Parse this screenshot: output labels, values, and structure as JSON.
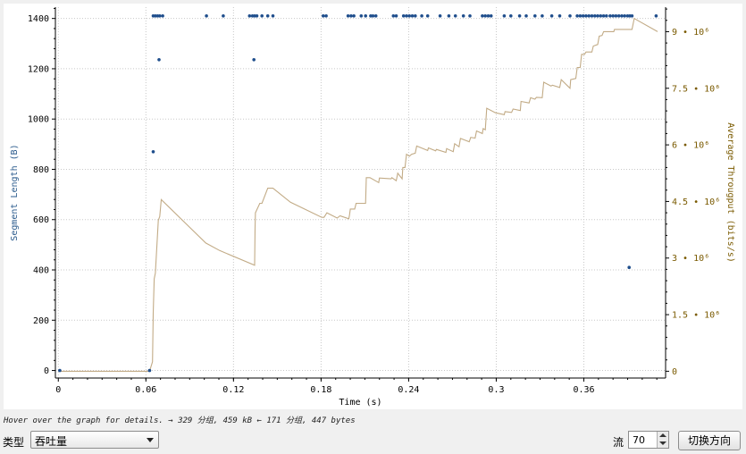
{
  "status_text": "Hover over the graph for details. → 329 分组, 459 kB ← 171 分组, 447 bytes",
  "controls": {
    "type_label": "类型",
    "type_value": "吞吐量",
    "stream_label": "流",
    "stream_value": "70",
    "switch_direction_label": "切换方向"
  },
  "colors": {
    "segment_points": "#1f4e8c",
    "throughput_line": "#c2ab86",
    "left_axis_text": "#2a5a8c",
    "right_axis_text": "#7a5a00"
  },
  "chart_data": {
    "type": "scatter",
    "grid": true,
    "xlabel": "Time (s)",
    "ylabel": "Segment Length (B)",
    "y2label": "Average Througput (bits/s)",
    "xlim": [
      -0.002,
      0.416
    ],
    "ylim": [
      -30,
      1445
    ],
    "y2lim": [
      -180000,
      9650000
    ],
    "x_ticks": [
      {
        "v": 0,
        "label": "0"
      },
      {
        "v": 0.06,
        "label": "0.06"
      },
      {
        "v": 0.12,
        "label": "0.12"
      },
      {
        "v": 0.18,
        "label": "0.18"
      },
      {
        "v": 0.24,
        "label": "0.24"
      },
      {
        "v": 0.3,
        "label": "0.3"
      },
      {
        "v": 0.36,
        "label": "0.36"
      }
    ],
    "y_ticks": [
      {
        "v": 0,
        "label": "0"
      },
      {
        "v": 200,
        "label": "200"
      },
      {
        "v": 400,
        "label": "400"
      },
      {
        "v": 600,
        "label": "600"
      },
      {
        "v": 800,
        "label": "800"
      },
      {
        "v": 1000,
        "label": "1000"
      },
      {
        "v": 1200,
        "label": "1200"
      },
      {
        "v": 1400,
        "label": "1400"
      }
    ],
    "y2_ticks": [
      {
        "v": 0,
        "label": "0"
      },
      {
        "v": 1500000,
        "label": "1.5 • 10⁶"
      },
      {
        "v": 3000000,
        "label": "3 • 10⁶"
      },
      {
        "v": 4500000,
        "label": "4.5 • 10⁶"
      },
      {
        "v": 6000000,
        "label": "6 • 10⁶"
      },
      {
        "v": 7500000,
        "label": "7.5 • 10⁶"
      },
      {
        "v": 9000000,
        "label": "9 • 10⁶"
      }
    ],
    "series": [
      {
        "name": "Segment Length",
        "kind": "points",
        "points": [
          [
            0.001,
            0
          ],
          [
            0.0625,
            0
          ],
          [
            0.065,
            870
          ],
          [
            0.069,
            1236
          ],
          [
            0.134,
            1236
          ],
          [
            0.391,
            410
          ],
          [
            0.065,
            1410
          ],
          [
            0.0665,
            1410
          ],
          [
            0.068,
            1410
          ],
          [
            0.0695,
            1410
          ],
          [
            0.0715,
            1410
          ],
          [
            0.1015,
            1410
          ],
          [
            0.113,
            1410
          ],
          [
            0.131,
            1410
          ],
          [
            0.133,
            1410
          ],
          [
            0.1345,
            1410
          ],
          [
            0.136,
            1410
          ],
          [
            0.1395,
            1410
          ],
          [
            0.1435,
            1410
          ],
          [
            0.147,
            1410
          ],
          [
            0.1815,
            1410
          ],
          [
            0.1835,
            1410
          ],
          [
            0.1985,
            1410
          ],
          [
            0.2005,
            1410
          ],
          [
            0.2025,
            1410
          ],
          [
            0.2075,
            1410
          ],
          [
            0.2105,
            1410
          ],
          [
            0.214,
            1410
          ],
          [
            0.2155,
            1410
          ],
          [
            0.2175,
            1410
          ],
          [
            0.2295,
            1410
          ],
          [
            0.2315,
            1410
          ],
          [
            0.2365,
            1410
          ],
          [
            0.2385,
            1410
          ],
          [
            0.2405,
            1410
          ],
          [
            0.2425,
            1410
          ],
          [
            0.2445,
            1410
          ],
          [
            0.249,
            1410
          ],
          [
            0.253,
            1410
          ],
          [
            0.2615,
            1410
          ],
          [
            0.2675,
            1410
          ],
          [
            0.272,
            1410
          ],
          [
            0.2775,
            1410
          ],
          [
            0.282,
            1410
          ],
          [
            0.2905,
            1410
          ],
          [
            0.2925,
            1410
          ],
          [
            0.2945,
            1410
          ],
          [
            0.2965,
            1410
          ],
          [
            0.3055,
            1410
          ],
          [
            0.31,
            1410
          ],
          [
            0.316,
            1410
          ],
          [
            0.3205,
            1410
          ],
          [
            0.3265,
            1410
          ],
          [
            0.3315,
            1410
          ],
          [
            0.338,
            1410
          ],
          [
            0.3435,
            1410
          ],
          [
            0.3505,
            1410
          ],
          [
            0.3555,
            1410
          ],
          [
            0.3575,
            1410
          ],
          [
            0.3595,
            1410
          ],
          [
            0.3615,
            1410
          ],
          [
            0.3635,
            1410
          ],
          [
            0.3655,
            1410
          ],
          [
            0.3675,
            1410
          ],
          [
            0.3695,
            1410
          ],
          [
            0.3715,
            1410
          ],
          [
            0.3735,
            1410
          ],
          [
            0.3755,
            1410
          ],
          [
            0.378,
            1410
          ],
          [
            0.38,
            1410
          ],
          [
            0.382,
            1410
          ],
          [
            0.384,
            1410
          ],
          [
            0.386,
            1410
          ],
          [
            0.388,
            1410
          ],
          [
            0.39,
            1410
          ],
          [
            0.3915,
            1410
          ],
          [
            0.393,
            1410
          ],
          [
            0.4095,
            1410
          ]
        ]
      },
      {
        "name": "Average Throughput",
        "kind": "line",
        "axis": "right",
        "points": [
          [
            0,
            0
          ],
          [
            0.0625,
            0
          ],
          [
            0.0645,
            250000
          ],
          [
            0.065,
            1550000
          ],
          [
            0.0657,
            2450000
          ],
          [
            0.0665,
            2600000
          ],
          [
            0.0685,
            4000000
          ],
          [
            0.0695,
            4100000
          ],
          [
            0.0705,
            4550000
          ],
          [
            0.101,
            3400000
          ],
          [
            0.1105,
            3200000
          ],
          [
            0.1345,
            2810000
          ],
          [
            0.1348,
            3800000
          ],
          [
            0.135,
            4200000
          ],
          [
            0.138,
            4450000
          ],
          [
            0.1395,
            4450000
          ],
          [
            0.1435,
            4850000
          ],
          [
            0.147,
            4850000
          ],
          [
            0.159,
            4480000
          ],
          [
            0.1805,
            4080000
          ],
          [
            0.182,
            4080000
          ],
          [
            0.184,
            4200000
          ],
          [
            0.191,
            4060000
          ],
          [
            0.193,
            4120000
          ],
          [
            0.199,
            4040000
          ],
          [
            0.1995,
            4140000
          ],
          [
            0.2,
            4300000
          ],
          [
            0.203,
            4300000
          ],
          [
            0.204,
            4450000
          ],
          [
            0.2105,
            4450000
          ],
          [
            0.211,
            5130000
          ],
          [
            0.2135,
            5130000
          ],
          [
            0.2195,
            5000000
          ],
          [
            0.22,
            5120000
          ],
          [
            0.228,
            5100000
          ],
          [
            0.2285,
            5130000
          ],
          [
            0.2315,
            5050000
          ],
          [
            0.2325,
            5250000
          ],
          [
            0.2355,
            5100000
          ],
          [
            0.236,
            5400000
          ],
          [
            0.2375,
            5400000
          ],
          [
            0.2385,
            5750000
          ],
          [
            0.2405,
            5700000
          ],
          [
            0.242,
            5750000
          ],
          [
            0.2445,
            5780000
          ],
          [
            0.2455,
            5970000
          ],
          [
            0.253,
            5850000
          ],
          [
            0.2535,
            5920000
          ],
          [
            0.2585,
            5840000
          ],
          [
            0.259,
            5880000
          ],
          [
            0.2655,
            5800000
          ],
          [
            0.266,
            5900000
          ],
          [
            0.2705,
            5820000
          ],
          [
            0.2715,
            6030000
          ],
          [
            0.2745,
            5950000
          ],
          [
            0.2755,
            6170000
          ],
          [
            0.2815,
            6080000
          ],
          [
            0.2825,
            6200000
          ],
          [
            0.2855,
            6180000
          ],
          [
            0.2865,
            6370000
          ],
          [
            0.2905,
            6300000
          ],
          [
            0.291,
            6430000
          ],
          [
            0.2925,
            6400000
          ],
          [
            0.2935,
            6970000
          ],
          [
            0.2995,
            6850000
          ],
          [
            0.3055,
            6800000
          ],
          [
            0.306,
            6880000
          ],
          [
            0.3105,
            6860000
          ],
          [
            0.3115,
            6950000
          ],
          [
            0.3165,
            6910000
          ],
          [
            0.317,
            7150000
          ],
          [
            0.3225,
            7110000
          ],
          [
            0.3235,
            7250000
          ],
          [
            0.3265,
            7210000
          ],
          [
            0.3275,
            7260000
          ],
          [
            0.3315,
            7250000
          ],
          [
            0.3325,
            7660000
          ],
          [
            0.3375,
            7560000
          ],
          [
            0.3385,
            7580000
          ],
          [
            0.3435,
            7520000
          ],
          [
            0.3445,
            7730000
          ],
          [
            0.3505,
            7500000
          ],
          [
            0.351,
            7730000
          ],
          [
            0.3545,
            7760000
          ],
          [
            0.3555,
            8050000
          ],
          [
            0.3575,
            8050000
          ],
          [
            0.3585,
            8400000
          ],
          [
            0.3605,
            8400000
          ],
          [
            0.3615,
            8460000
          ],
          [
            0.3655,
            8460000
          ],
          [
            0.3665,
            8620000
          ],
          [
            0.3695,
            8660000
          ],
          [
            0.3705,
            8880000
          ],
          [
            0.3725,
            8900000
          ],
          [
            0.3735,
            9000000
          ],
          [
            0.3805,
            9000000
          ],
          [
            0.381,
            9060000
          ],
          [
            0.393,
            9060000
          ],
          [
            0.3945,
            9350000
          ],
          [
            0.4105,
            9000000
          ]
        ]
      }
    ]
  }
}
